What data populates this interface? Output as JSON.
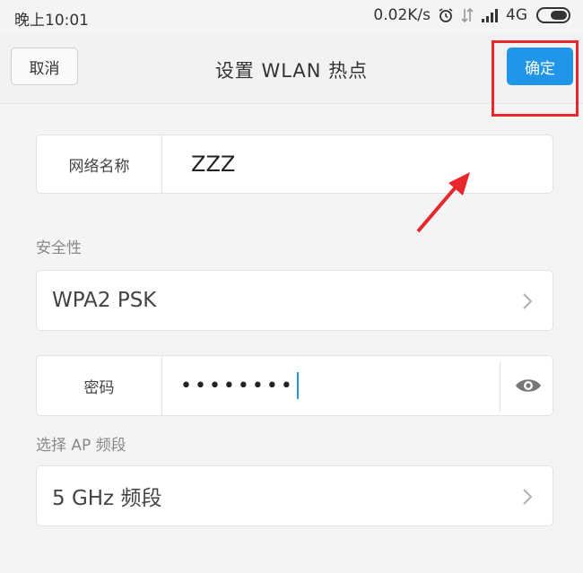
{
  "status_bar": {
    "time": "晚上10:01",
    "speed": "0.02K/s",
    "network": "4G"
  },
  "header": {
    "cancel_label": "取消",
    "title": "设置 WLAN 热点",
    "confirm_label": "确定"
  },
  "form": {
    "network_name_label": "网络名称",
    "network_name_value": "ZZZ",
    "security_section": "安全性",
    "security_value": "WPA2 PSK",
    "password_label": "密码",
    "password_value": "••••••••",
    "band_section": "选择 AP 频段",
    "band_value": "5 GHz 频段"
  },
  "colors": {
    "accent": "#2196e8",
    "annotation": "#e8262b"
  }
}
